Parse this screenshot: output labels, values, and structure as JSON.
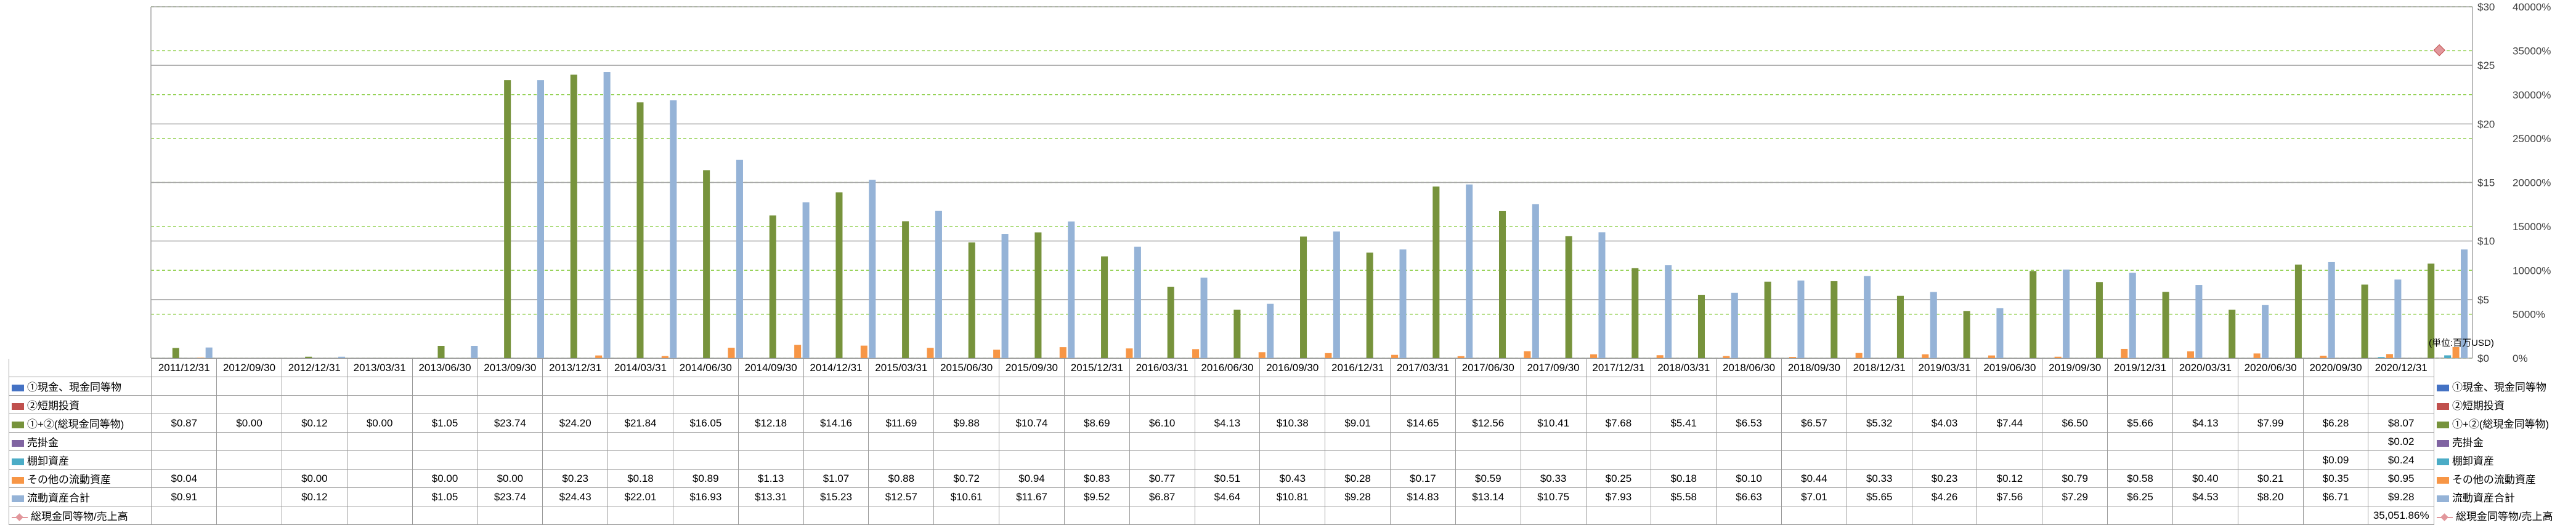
{
  "chart_data": {
    "type": "bar",
    "unit_note": "(単位:百万USD)",
    "categories": [
      "2011/12/31",
      "2012/09/30",
      "2012/12/31",
      "2013/03/31",
      "2013/06/30",
      "2013/09/30",
      "2013/12/31",
      "2014/03/31",
      "2014/06/30",
      "2014/09/30",
      "2014/12/31",
      "2015/03/31",
      "2015/06/30",
      "2015/09/30",
      "2015/12/31",
      "2016/03/31",
      "2016/06/30",
      "2016/09/30",
      "2016/12/31",
      "2017/03/31",
      "2017/06/30",
      "2017/09/30",
      "2017/12/31",
      "2018/03/31",
      "2018/06/30",
      "2018/09/30",
      "2018/12/31",
      "2019/03/31",
      "2019/06/30",
      "2019/09/30",
      "2019/12/31",
      "2020/03/31",
      "2020/06/30",
      "2020/09/30",
      "2020/12/31"
    ],
    "y_left": {
      "min": 0,
      "max": 30,
      "ticks": [
        "$0",
        "$5",
        "$10",
        "$15",
        "$20",
        "$25",
        "$30"
      ]
    },
    "y_right": {
      "min": 0,
      "max": 40000,
      "ticks": [
        "0%",
        "5000%",
        "10000%",
        "15000%",
        "20000%",
        "25000%",
        "30000%",
        "35000%",
        "40000%"
      ]
    },
    "series": [
      {
        "name": "①現金、現金同等物",
        "color": "#4472c4",
        "labels": [
          "",
          "",
          "",
          "",
          "",
          "",
          "",
          "",
          "",
          "",
          "",
          "",
          "",
          "",
          "",
          "",
          "",
          "",
          "",
          "",
          "",
          "",
          "",
          "",
          "",
          "",
          "",
          "",
          "",
          "",
          "",
          "",
          "",
          "",
          ""
        ],
        "values": [
          null,
          null,
          null,
          null,
          null,
          null,
          null,
          null,
          null,
          null,
          null,
          null,
          null,
          null,
          null,
          null,
          null,
          null,
          null,
          null,
          null,
          null,
          null,
          null,
          null,
          null,
          null,
          null,
          null,
          null,
          null,
          null,
          null,
          null,
          null
        ]
      },
      {
        "name": "②短期投資",
        "color": "#c0504d",
        "labels": [
          "",
          "",
          "",
          "",
          "",
          "",
          "",
          "",
          "",
          "",
          "",
          "",
          "",
          "",
          "",
          "",
          "",
          "",
          "",
          "",
          "",
          "",
          "",
          "",
          "",
          "",
          "",
          "",
          "",
          "",
          "",
          "",
          "",
          "",
          ""
        ],
        "values": [
          null,
          null,
          null,
          null,
          null,
          null,
          null,
          null,
          null,
          null,
          null,
          null,
          null,
          null,
          null,
          null,
          null,
          null,
          null,
          null,
          null,
          null,
          null,
          null,
          null,
          null,
          null,
          null,
          null,
          null,
          null,
          null,
          null,
          null,
          null
        ]
      },
      {
        "name": "①+②(総現金同等物)",
        "color": "#77933c",
        "labels": [
          "$0.87",
          "$0.00",
          "$0.12",
          "$0.00",
          "$1.05",
          "$23.74",
          "$24.20",
          "$21.84",
          "$16.05",
          "$12.18",
          "$14.16",
          "$11.69",
          "$9.88",
          "$10.74",
          "$8.69",
          "$6.10",
          "$4.13",
          "$10.38",
          "$9.01",
          "$14.65",
          "$12.56",
          "$10.41",
          "$7.68",
          "$5.41",
          "$6.53",
          "$6.57",
          "$5.32",
          "$4.03",
          "$7.44",
          "$6.50",
          "$5.66",
          "$4.13",
          "$7.99",
          "$6.28",
          "$8.07"
        ],
        "values": [
          0.87,
          0.0,
          0.12,
          0.0,
          1.05,
          23.74,
          24.2,
          21.84,
          16.05,
          12.18,
          14.16,
          11.69,
          9.88,
          10.74,
          8.69,
          6.1,
          4.13,
          10.38,
          9.01,
          14.65,
          12.56,
          10.41,
          7.68,
          5.41,
          6.53,
          6.57,
          5.32,
          4.03,
          7.44,
          6.5,
          5.66,
          4.13,
          7.99,
          6.28,
          8.07
        ]
      },
      {
        "name": "売掛金",
        "color": "#8064a2",
        "labels": [
          "",
          "",
          "",
          "",
          "",
          "",
          "",
          "",
          "",
          "",
          "",
          "",
          "",
          "",
          "",
          "",
          "",
          "",
          "",
          "",
          "",
          "",
          "",
          "",
          "",
          "",
          "",
          "",
          "",
          "",
          "",
          "",
          "",
          "",
          "$0.02"
        ],
        "values": [
          null,
          null,
          null,
          null,
          null,
          null,
          null,
          null,
          null,
          null,
          null,
          null,
          null,
          null,
          null,
          null,
          null,
          null,
          null,
          null,
          null,
          null,
          null,
          null,
          null,
          null,
          null,
          null,
          null,
          null,
          null,
          null,
          null,
          null,
          0.02
        ]
      },
      {
        "name": "棚卸資産",
        "color": "#4bacc6",
        "labels": [
          "",
          "",
          "",
          "",
          "",
          "",
          "",
          "",
          "",
          "",
          "",
          "",
          "",
          "",
          "",
          "",
          "",
          "",
          "",
          "",
          "",
          "",
          "",
          "",
          "",
          "",
          "",
          "",
          "",
          "",
          "",
          "",
          "",
          "$0.09",
          "$0.24"
        ],
        "values": [
          null,
          null,
          null,
          null,
          null,
          null,
          null,
          null,
          null,
          null,
          null,
          null,
          null,
          null,
          null,
          null,
          null,
          null,
          null,
          null,
          null,
          null,
          null,
          null,
          null,
          null,
          null,
          null,
          null,
          null,
          null,
          null,
          null,
          0.09,
          0.24
        ]
      },
      {
        "name": "その他の流動資産",
        "color": "#f79646",
        "labels": [
          "$0.04",
          "",
          "$0.00",
          "",
          "$0.00",
          "$0.00",
          "$0.23",
          "$0.18",
          "$0.89",
          "$1.13",
          "$1.07",
          "$0.88",
          "$0.72",
          "$0.94",
          "$0.83",
          "$0.77",
          "$0.51",
          "$0.43",
          "$0.28",
          "$0.17",
          "$0.59",
          "$0.33",
          "$0.25",
          "$0.18",
          "$0.10",
          "$0.44",
          "$0.33",
          "$0.23",
          "$0.12",
          "$0.79",
          "$0.58",
          "$0.40",
          "$0.21",
          "$0.35",
          "$0.95"
        ],
        "values": [
          0.04,
          null,
          0.0,
          null,
          0.0,
          0.0,
          0.23,
          0.18,
          0.89,
          1.13,
          1.07,
          0.88,
          0.72,
          0.94,
          0.83,
          0.77,
          0.51,
          0.43,
          0.28,
          0.17,
          0.59,
          0.33,
          0.25,
          0.18,
          0.1,
          0.44,
          0.33,
          0.23,
          0.12,
          0.79,
          0.58,
          0.4,
          0.21,
          0.35,
          0.95
        ]
      },
      {
        "name": "流動資産合計",
        "color": "#95b3d7",
        "labels": [
          "$0.91",
          "",
          "$0.12",
          "",
          "$1.05",
          "$23.74",
          "$24.43",
          "$22.01",
          "$16.93",
          "$13.31",
          "$15.23",
          "$12.57",
          "$10.61",
          "$11.67",
          "$9.52",
          "$6.87",
          "$4.64",
          "$10.81",
          "$9.28",
          "$14.83",
          "$13.14",
          "$10.75",
          "$7.93",
          "$5.58",
          "$6.63",
          "$7.01",
          "$5.65",
          "$4.26",
          "$7.56",
          "$7.29",
          "$6.25",
          "$4.53",
          "$8.20",
          "$6.71",
          "$9.28"
        ],
        "values": [
          0.91,
          null,
          0.12,
          null,
          1.05,
          23.74,
          24.43,
          22.01,
          16.93,
          13.31,
          15.23,
          12.57,
          10.61,
          11.67,
          9.52,
          6.87,
          4.64,
          10.81,
          9.28,
          14.83,
          13.14,
          10.75,
          7.93,
          5.58,
          6.63,
          7.01,
          5.65,
          4.26,
          7.56,
          7.29,
          6.25,
          4.53,
          8.2,
          6.71,
          9.28
        ]
      },
      {
        "name": "総現金同等物/売上高",
        "color": "#e2979c",
        "axis": "right",
        "marker": "diamond",
        "labels": [
          "",
          "",
          "",
          "",
          "",
          "",
          "",
          "",
          "",
          "",
          "",
          "",
          "",
          "",
          "",
          "",
          "",
          "",
          "",
          "",
          "",
          "",
          "",
          "",
          "",
          "",
          "",
          "",
          "",
          "",
          "",
          "",
          "",
          "",
          "35,051.86%"
        ],
        "values": [
          null,
          null,
          null,
          null,
          null,
          null,
          null,
          null,
          null,
          null,
          null,
          null,
          null,
          null,
          null,
          null,
          null,
          null,
          null,
          null,
          null,
          null,
          null,
          null,
          null,
          null,
          null,
          null,
          null,
          null,
          null,
          null,
          null,
          null,
          35051.86
        ]
      }
    ]
  }
}
